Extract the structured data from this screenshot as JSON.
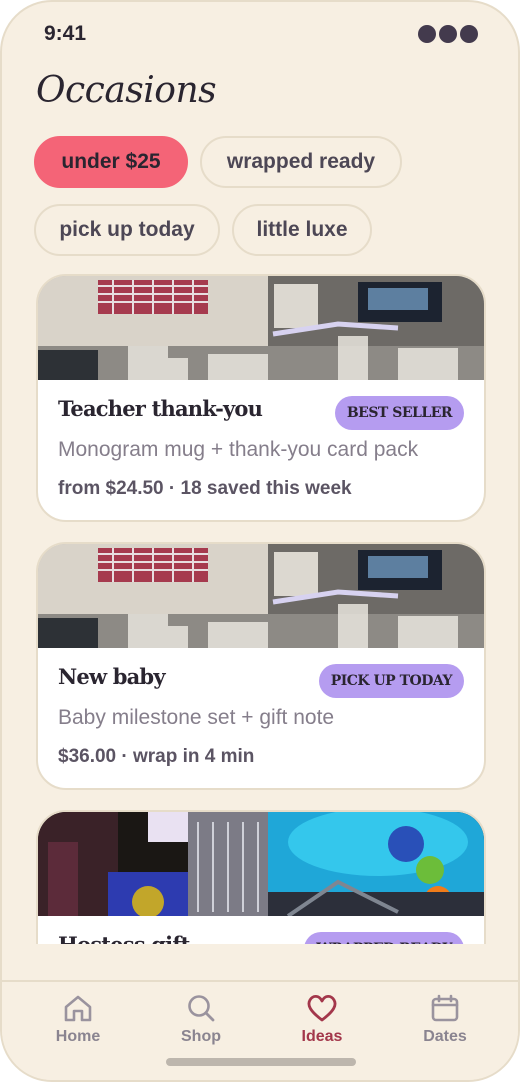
{
  "status": {
    "time": "9:41"
  },
  "page": {
    "title": "Occasions"
  },
  "filters": [
    {
      "label": "under $25",
      "active": true
    },
    {
      "label": "wrapped ready",
      "active": false
    },
    {
      "label": "pick up today",
      "active": false
    },
    {
      "label": "little luxe",
      "active": false
    }
  ],
  "cards": [
    {
      "title": "Teacher thank-you",
      "badge": "BEST SELLER",
      "subtitle": "Monogram mug + thank-you card pack",
      "meta": "from $24.50 · 18 saved this week"
    },
    {
      "title": "New baby",
      "badge": "PICK UP TODAY",
      "subtitle": "Baby milestone set + gift note",
      "meta": "$36.00 · wrap in 4 min"
    },
    {
      "title": "Hostess gift",
      "badge": "WRAPPED READY",
      "subtitle": "",
      "meta": ""
    }
  ],
  "nav": {
    "items": [
      {
        "label": "Home",
        "icon": "home-icon",
        "active": false
      },
      {
        "label": "Shop",
        "icon": "search-icon",
        "active": false
      },
      {
        "label": "Ideas",
        "icon": "heart-icon",
        "active": true
      },
      {
        "label": "Dates",
        "icon": "calendar-icon",
        "active": false
      }
    ]
  },
  "colors": {
    "background": "#f7efe2",
    "accent_chip": "#f46477",
    "badge": "#b59cf0",
    "active_nav": "#a3374b"
  }
}
